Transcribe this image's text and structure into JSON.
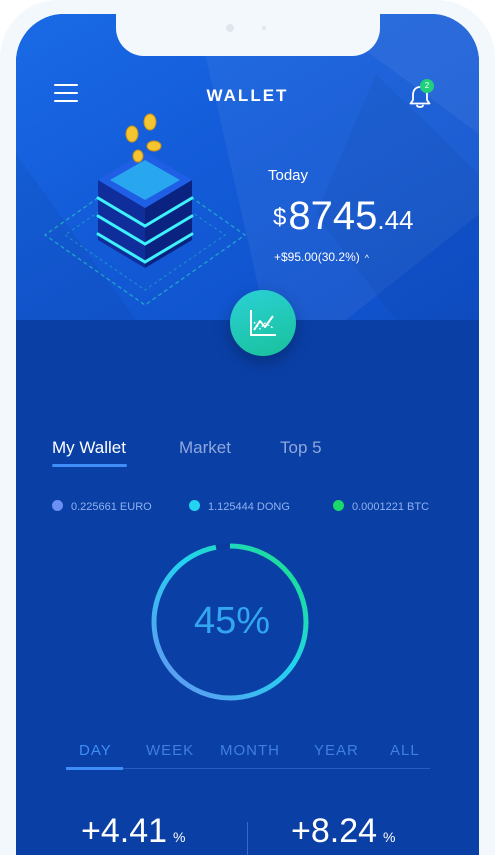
{
  "header": {
    "title": "WALLET",
    "notification_count": "2"
  },
  "balance": {
    "label": "Today",
    "currency": "$",
    "integer": "8745",
    "decimal": ".44",
    "change": "+$95.00(30.2%)",
    "change_arrow": "^"
  },
  "tabs": [
    {
      "label": "My Wallet",
      "active": true
    },
    {
      "label": "Market",
      "active": false
    },
    {
      "label": "Top 5",
      "active": false
    }
  ],
  "legend": [
    {
      "label": "0.225661 EURO",
      "color": "#6b8ff2"
    },
    {
      "label": "1.125444 DONG",
      "color": "#24d3f0"
    },
    {
      "label": "0.0001221 BTC",
      "color": "#19d96a"
    }
  ],
  "progress": {
    "label": "45%",
    "value": 45
  },
  "periods": [
    {
      "label": "DAY",
      "active": true
    },
    {
      "label": "WEEK",
      "active": false
    },
    {
      "label": "MONTH",
      "active": false
    },
    {
      "label": "YEAR",
      "active": false
    },
    {
      "label": "ALL",
      "active": false
    }
  ],
  "stats": [
    {
      "value": "+4.41",
      "unit": "%"
    },
    {
      "value": "+8.24",
      "unit": "%"
    }
  ],
  "colors": {
    "hero_blue": "#135bd8",
    "screen_blue": "#0a3fa6",
    "accent": "#3f8ef7",
    "teal": "#2bd1d6"
  }
}
